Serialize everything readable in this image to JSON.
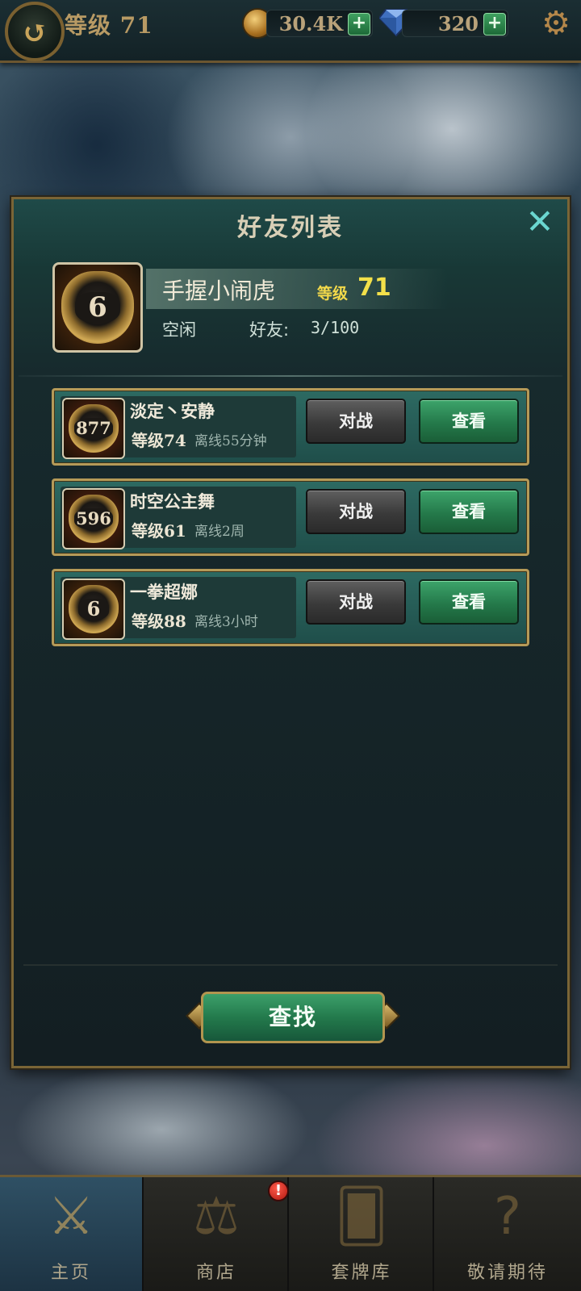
{
  "header": {
    "level_text": "等级 71",
    "coins": "30.4K",
    "gems": "320",
    "back_icon": "back-arrow-icon",
    "settings_icon": "gear-icon",
    "coin_icon": "coin-icon",
    "gem_icon": "diamond-icon",
    "add_icon": "plus-icon"
  },
  "panel": {
    "title": "好友列表",
    "close_icon": "close-icon"
  },
  "me": {
    "avatar_number": "6",
    "name": "手握小闹虎",
    "level_label": "等级",
    "level": "71",
    "status": "空闲",
    "friends_label": "好友:",
    "friends_count": "3/100"
  },
  "friends": [
    {
      "avatar_number": "877",
      "name": "淡定丶安静",
      "level": "等级74",
      "last_seen": "离线55分钟",
      "battle_label": "对战",
      "view_label": "查看"
    },
    {
      "avatar_number": "596",
      "name": "时空公主舞",
      "level": "等级61",
      "last_seen": "离线2周",
      "battle_label": "对战",
      "view_label": "查看"
    },
    {
      "avatar_number": "6",
      "name": "一拳超娜",
      "level": "等级88",
      "last_seen": "离线3小时",
      "battle_label": "对战",
      "view_label": "查看"
    }
  ],
  "search_label": "查找",
  "nav": [
    {
      "label": "主页",
      "icon": "crossed-swords-icon",
      "active": true
    },
    {
      "label": "商店",
      "icon": "scales-icon",
      "active": false,
      "badge": "!"
    },
    {
      "label": "套牌库",
      "icon": "cards-icon",
      "active": false
    },
    {
      "label": "敬请期待",
      "icon": "question-mark-icon",
      "active": false
    }
  ],
  "colors": {
    "accent_gold": "#b59a58",
    "level_yellow": "#f3e04a",
    "button_green": "#24794a",
    "close_cyan": "#6ad6d0"
  }
}
